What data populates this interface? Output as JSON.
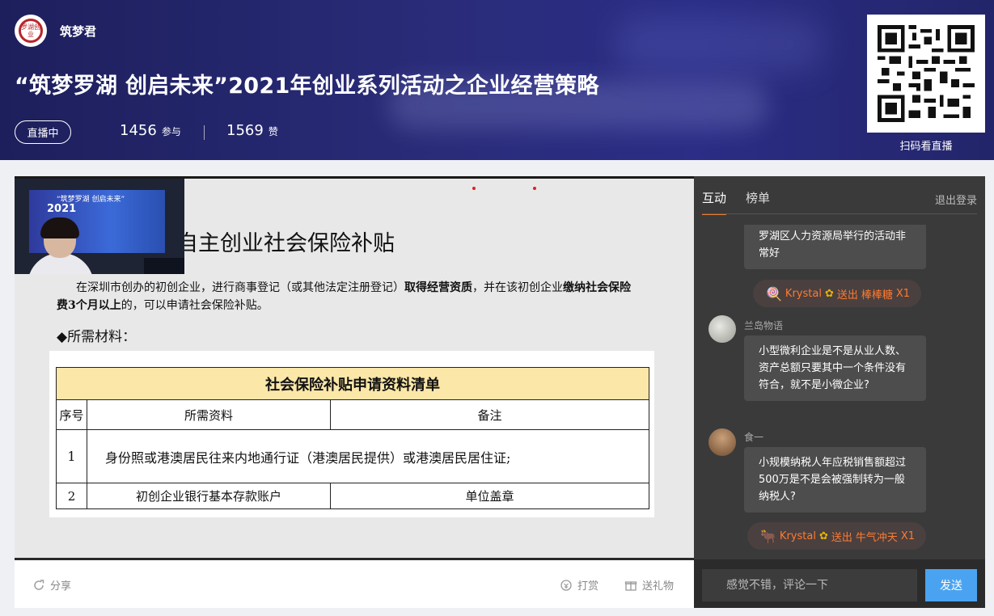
{
  "header": {
    "logo_text": "罗湖创业",
    "host_name": "筑梦君",
    "title": "“筑梦罗湖 创启未来”2021年创业系列活动之企业经营策略",
    "live_status": "直播中",
    "participants": "1456",
    "participants_unit": "参与",
    "likes": "1569",
    "likes_unit": "赞",
    "qr_caption": "扫码看直播"
  },
  "video": {
    "pip": {
      "screen_line1": "“筑梦罗湖 创启未来”",
      "screen_line2": "2021"
    },
    "slide": {
      "title": "自主创业社会保险补贴",
      "para_1": "在深圳市创办的初创企业，进行商事登记（或其他法定注册登记）",
      "para_bold_1": "取得经营资质",
      "para_2": "，并在该初创企业",
      "para_bold_2": "缴纳社会保险费3个月以上",
      "para_3": "的，可以申请社会保险补贴。",
      "materials_heading": "◆所需材料："
    },
    "table": {
      "title": "社会保险补贴申请资料清单",
      "columns": [
        "序号",
        "所需资料",
        "备注"
      ],
      "rows": [
        {
          "no": "1",
          "material": "身份照或港澳居民往来内地通行证（港澳居民提供）或港澳居民居住证;",
          "note": ""
        },
        {
          "no": "2",
          "material": "初创企业银行基本存款账户",
          "note": "单位盖章"
        }
      ]
    }
  },
  "actions": {
    "share": "分享",
    "tip": "打赏",
    "gift": "送礼物"
  },
  "chat": {
    "tabs": [
      "互动",
      "榜单"
    ],
    "logout": "退出登录",
    "messages": [
      {
        "type": "text",
        "nick": "",
        "text": "罗湖区人力资源局举行的活动非常好"
      },
      {
        "type": "gift",
        "user": "Krystal",
        "action": "送出",
        "item": "棒棒糖",
        "count": "X1"
      },
      {
        "type": "text",
        "nick": "兰岛物语",
        "text": "小型微利企业是不是从业人数、资产总额只要其中一个条件没有符合，就不是小微企业?"
      },
      {
        "type": "text",
        "nick": "食一",
        "text": "小规模纳税人年应税销售额超过500万是不是会被强制转为一般纳税人?"
      },
      {
        "type": "gift",
        "user": "Krystal",
        "action": "送出",
        "item": "牛气冲天",
        "count": "X1"
      }
    ],
    "input_placeholder": "感觉不错，评论一下",
    "send_label": "发送"
  },
  "colors": {
    "banner": "#2a2c7a",
    "accent_orange": "#f07b2f",
    "send_blue": "#4aa3f0",
    "chat_bg": "#3a3a3a"
  },
  "icons": [
    "share-icon",
    "tip-icon",
    "gift-icon",
    "lollipop-icon",
    "bull-icon",
    "flower-icon"
  ]
}
